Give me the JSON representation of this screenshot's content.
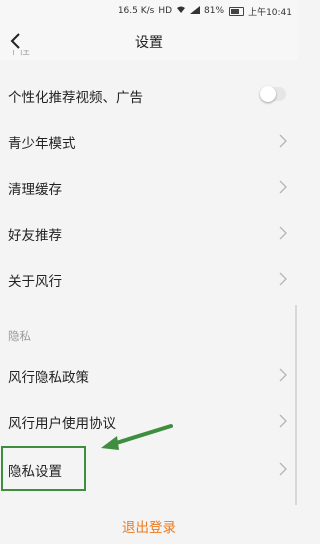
{
  "status_bar": {
    "speed": "16.5 K/s",
    "battery_percent": "81%",
    "time": "上午10:41",
    "icons": [
      "hd-icon",
      "wifi-icon",
      "signal-icon",
      "battery-icon"
    ]
  },
  "nav": {
    "title": "设置",
    "back_icon": "chevron-left-icon"
  },
  "partial_section": "个性",
  "rows_top": [
    {
      "label": "个性化推荐视频、广告",
      "control": "toggle",
      "toggle_on": false
    },
    {
      "label": "青少年模式",
      "control": "chevron"
    },
    {
      "label": "清理缓存",
      "control": "chevron"
    },
    {
      "label": "好友推荐",
      "control": "chevron"
    },
    {
      "label": "关于风行",
      "control": "chevron"
    }
  ],
  "privacy_section": {
    "header": "隐私",
    "rows": [
      {
        "label": "风行隐私政策",
        "control": "chevron"
      },
      {
        "label": "风行用户使用协议",
        "control": "chevron"
      },
      {
        "label": "隐私设置",
        "control": "chevron"
      }
    ]
  },
  "logout_label": "退出登录",
  "colors": {
    "accent": "#ee7a1e",
    "highlight_box": "#3f8d3f",
    "background": "#f4f4f4"
  }
}
